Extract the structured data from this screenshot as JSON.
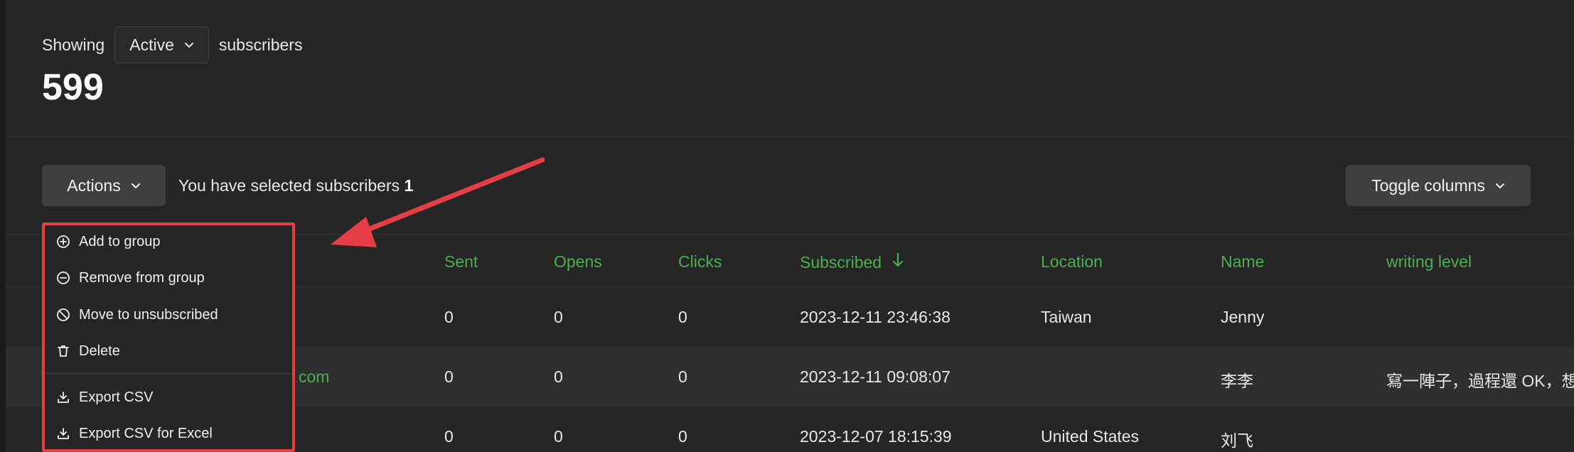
{
  "header": {
    "showing_prefix": "Showing",
    "filter_value": "Active",
    "showing_suffix": "subscribers",
    "count": "599"
  },
  "toolbar": {
    "actions_label": "Actions",
    "selected_text": "You have selected subscribers",
    "selected_count": "1",
    "toggle_columns_label": "Toggle columns"
  },
  "table": {
    "columns": [
      "Sent",
      "Opens",
      "Clicks",
      "Subscribed",
      "Location",
      "Name",
      "writing level"
    ],
    "rows": [
      {
        "email": "",
        "sent": "0",
        "opens": "0",
        "clicks": "0",
        "subscribed": "2023-12-11 23:46:38",
        "location": "Taiwan",
        "name": "Jenny",
        "writing_level": ""
      },
      {
        "email": "com",
        "sent": "0",
        "opens": "0",
        "clicks": "0",
        "subscribed": "2023-12-11 09:08:07",
        "location": "",
        "name": "李李",
        "writing_level": "寫一陣子，過程還 OK，想"
      },
      {
        "email": "",
        "sent": "0",
        "opens": "0",
        "clicks": "0",
        "subscribed": "2023-12-07 18:15:39",
        "location": "United States",
        "name": "刘飞",
        "writing_level": ""
      }
    ]
  },
  "actions_menu": {
    "items": [
      {
        "label": "Add to group",
        "icon": "plus-circle-icon"
      },
      {
        "label": "Remove from group",
        "icon": "minus-circle-icon"
      },
      {
        "label": "Move to unsubscribed",
        "icon": "ban-icon"
      },
      {
        "label": "Delete",
        "icon": "trash-icon"
      },
      {
        "label": "Export CSV",
        "icon": "download-icon"
      },
      {
        "label": "Export CSV for Excel",
        "icon": "download-icon"
      }
    ]
  },
  "colors": {
    "accent_green": "#4caf50",
    "annotation_red": "#e53e45",
    "panel_bg": "#262626"
  }
}
